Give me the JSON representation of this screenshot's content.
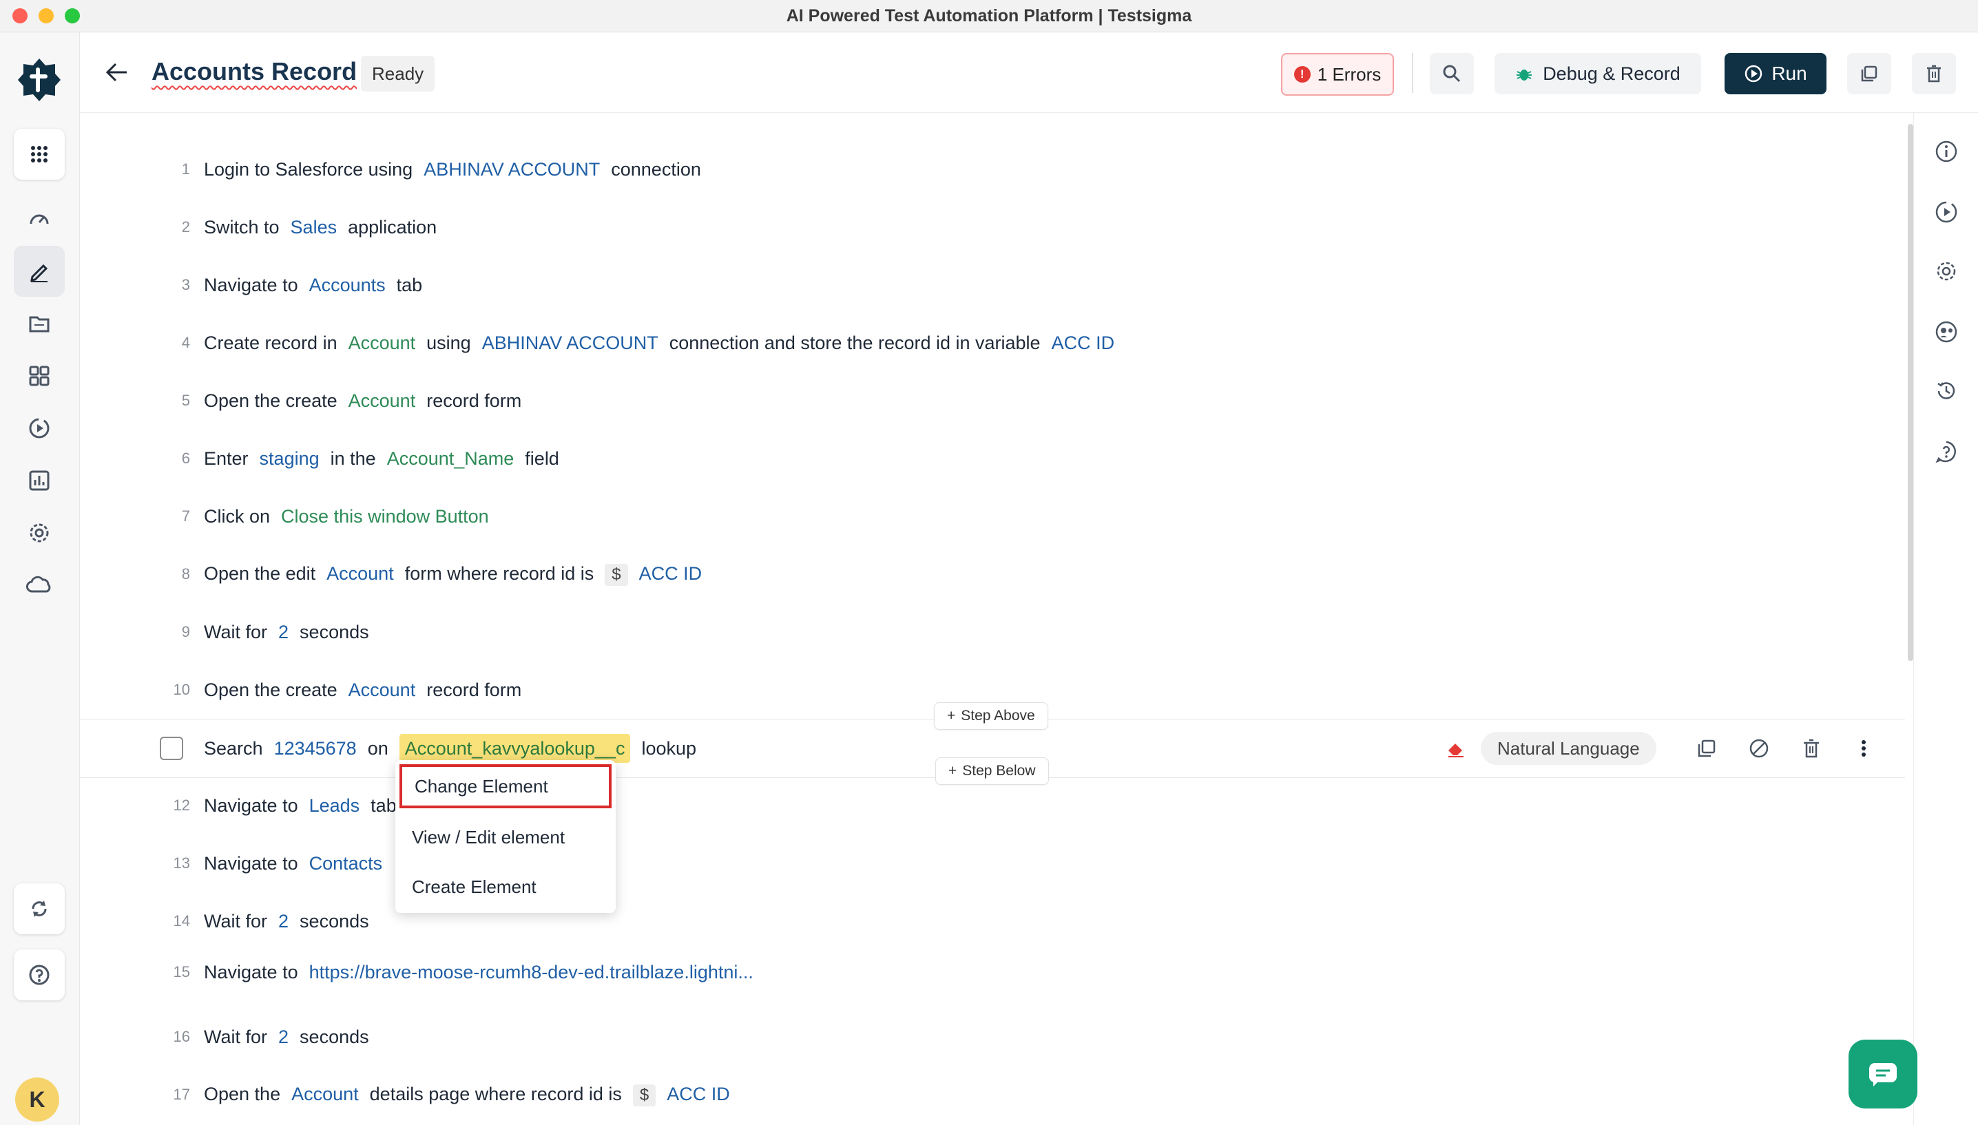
{
  "window": {
    "title": "AI Powered Test Automation Platform | Testsigma"
  },
  "header": {
    "title": "Accounts Record",
    "status": "Ready",
    "errors_label": "1 Errors",
    "errors_icon": "!",
    "debug_label": "Debug & Record",
    "run_label": "Run"
  },
  "user": {
    "initial": "K"
  },
  "steps": [
    {
      "num": "1",
      "parts": [
        "Login to Salesforce using",
        "ABHINAV ACCOUNT",
        "connection"
      ]
    },
    {
      "num": "2",
      "parts": [
        "Switch to",
        "Sales",
        "application"
      ]
    },
    {
      "num": "3",
      "parts": [
        "Navigate to",
        "Accounts",
        "tab"
      ]
    },
    {
      "num": "4",
      "parts": [
        "Create record in",
        "Account",
        "using",
        "ABHINAV ACCOUNT",
        "connection and store the record id in variable",
        "ACC ID"
      ]
    },
    {
      "num": "5",
      "parts": [
        "Open the create",
        "Account",
        "record form"
      ]
    },
    {
      "num": "6",
      "parts": [
        "Enter",
        "staging",
        "in the",
        "Account_Name",
        "field"
      ]
    },
    {
      "num": "7",
      "parts": [
        "Click on",
        "Close this window Button"
      ]
    },
    {
      "num": "8",
      "parts": [
        "Open the edit",
        "Account",
        "form where record id is",
        "$",
        "ACC ID"
      ]
    },
    {
      "num": "9",
      "parts": [
        "Wait for",
        "2",
        "seconds"
      ]
    },
    {
      "num": "10",
      "parts": [
        "Open the create",
        "Account",
        "record form"
      ]
    },
    {
      "num": "11",
      "parts": [
        "Search",
        "12345678",
        "on",
        "Account_kavvyalookup__c",
        "lookup"
      ]
    },
    {
      "num": "12",
      "parts": [
        "Navigate to",
        "Leads",
        "tab"
      ]
    },
    {
      "num": "13",
      "parts": [
        "Navigate to",
        "Contacts"
      ]
    },
    {
      "num": "14",
      "parts": [
        "Wait for",
        "2",
        "seconds"
      ]
    },
    {
      "num": "15",
      "parts": [
        "Navigate to",
        "https://brave-moose-rcumh8-dev-ed.trailblaze.lightni..."
      ]
    },
    {
      "num": "16",
      "parts": [
        "Wait for",
        "2",
        "seconds"
      ]
    },
    {
      "num": "17",
      "parts": [
        "Open the",
        "Account",
        "details page where record id is",
        "$",
        "ACC ID"
      ]
    }
  ],
  "selected_step": {
    "step_above": "Step Above",
    "step_below": "Step Below",
    "plus": "+",
    "mode": "Natural Language"
  },
  "context_menu": {
    "items": [
      "Change Element",
      "View / Edit element",
      "Create Element"
    ]
  },
  "colors": {
    "accent": "#103144",
    "parameter": "#1f5fa6",
    "element": "#2e8b57",
    "highlight": "#f9e27a",
    "error": "#e53935"
  }
}
